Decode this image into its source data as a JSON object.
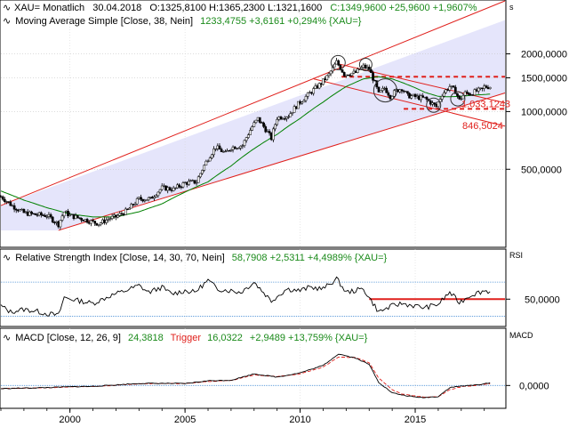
{
  "panel_price": {
    "header_symbol": "XAU= Monatlich",
    "header_date": "30.04.2018",
    "header_ohlc": "O:1325,8100 H:1365,2300 L:1321,1600",
    "header_close": "C:1349,9600 +25,9600 +1,9607%",
    "ma_label": "Moving Average Simple [Close, 38, Nein]",
    "ma_values": "1233,4755 +3,6161 +0,294% {XAU=}",
    "scale_letter": "s",
    "annotations": [
      "1.033,1243",
      "846,5024"
    ],
    "colors": {
      "candles": "#000000",
      "ma": "#008000",
      "channel_line": "#e0201c",
      "channel_fill": "#dcdcfa",
      "annotation": "#e0201c",
      "circle": "#333333"
    }
  },
  "panel_rsi": {
    "label": "Relative Strength Index [Close, 14, 30, 70, Nein]",
    "values": "58,7908 +2,5311 +4,4989% {XAU=}",
    "axis_title": "RSI",
    "colors": {
      "line": "#000000",
      "level": "#e0201c",
      "bands": "#4a8fd6"
    }
  },
  "panel_macd": {
    "label": "MACD [Close, 12, 26, 9]",
    "value": "24,3818",
    "trigger_label": "Trigger",
    "trigger_value": "16,0322",
    "change": "+2,9489 +13,759% {XAU=}",
    "axis_title": "MACD",
    "colors": {
      "macd": "#000000",
      "trigger": "#e0201c",
      "zero": "#4a8fd6"
    }
  },
  "chart_data": [
    {
      "type": "candlestick",
      "title": "XAU= Monatlich",
      "y_scale": "log",
      "y_ticks": [
        {
          "value": 2000,
          "label": "2000,0000"
        },
        {
          "value": 1500,
          "label": "1500,0000"
        },
        {
          "value": 1000,
          "label": "1000,0000"
        },
        {
          "value": 500,
          "label": "500,0000"
        }
      ],
      "x_ticks": [
        "2000",
        "2005",
        "2010",
        "2015"
      ],
      "ylim": [
        200,
        2600
      ],
      "series": [
        {
          "name": "XAU=",
          "points": [
            [
              "1997-01",
              360
            ],
            [
              "1997-07",
              322
            ],
            [
              "1998-01",
              296
            ],
            [
              "1998-07",
              290
            ],
            [
              "1999-01",
              287
            ],
            [
              "1999-07",
              258
            ],
            [
              "1999-10",
              300
            ],
            [
              "2000-01",
              287
            ],
            [
              "2000-07",
              276
            ],
            [
              "2001-01",
              265
            ],
            [
              "2001-04",
              260
            ],
            [
              "2001-10",
              278
            ],
            [
              "2002-01",
              282
            ],
            [
              "2002-07",
              305
            ],
            [
              "2003-01",
              350
            ],
            [
              "2003-07",
              350
            ],
            [
              "2004-01",
              400
            ],
            [
              "2004-07",
              393
            ],
            [
              "2005-01",
              424
            ],
            [
              "2005-07",
              430
            ],
            [
              "2006-01",
              569
            ],
            [
              "2006-05",
              653
            ],
            [
              "2006-10",
              604
            ],
            [
              "2007-01",
              650
            ],
            [
              "2007-07",
              666
            ],
            [
              "2007-12",
              834
            ],
            [
              "2008-03",
              917
            ],
            [
              "2008-10",
              725
            ],
            [
              "2009-01",
              928
            ],
            [
              "2009-07",
              955
            ],
            [
              "2009-12",
              1096
            ],
            [
              "2010-06",
              1245
            ],
            [
              "2010-12",
              1405
            ],
            [
              "2011-04",
              1556
            ],
            [
              "2011-08",
              1813
            ],
            [
              "2011-12",
              1565
            ],
            [
              "2012-06",
              1597
            ],
            [
              "2012-10",
              1719
            ],
            [
              "2013-01",
              1663
            ],
            [
              "2013-06",
              1234
            ],
            [
              "2013-09",
              1327
            ],
            [
              "2013-12",
              1201
            ],
            [
              "2014-03",
              1284
            ],
            [
              "2014-06",
              1322
            ],
            [
              "2014-09",
              1210
            ],
            [
              "2014-12",
              1199
            ],
            [
              "2015-03",
              1183
            ],
            [
              "2015-06",
              1172
            ],
            [
              "2015-09",
              1115
            ],
            [
              "2015-12",
              1061
            ],
            [
              "2016-03",
              1232
            ],
            [
              "2016-07",
              1351
            ],
            [
              "2016-10",
              1277
            ],
            [
              "2016-12",
              1146
            ],
            [
              "2017-03",
              1249
            ],
            [
              "2017-06",
              1242
            ],
            [
              "2017-09",
              1280
            ],
            [
              "2017-12",
              1303
            ],
            [
              "2018-01",
              1345
            ],
            [
              "2018-04",
              1350
            ]
          ]
        },
        {
          "name": "Moving Average Simple 38",
          "points": [
            [
              "1997-01",
              385
            ],
            [
              "1998-01",
              345
            ],
            [
              "1999-01",
              315
            ],
            [
              "2000-01",
              292
            ],
            [
              "2001-01",
              282
            ],
            [
              "2002-01",
              282
            ],
            [
              "2003-01",
              300
            ],
            [
              "2004-01",
              330
            ],
            [
              "2005-01",
              380
            ],
            [
              "2006-01",
              430
            ],
            [
              "2007-01",
              520
            ],
            [
              "2008-01",
              640
            ],
            [
              "2009-01",
              760
            ],
            [
              "2010-01",
              920
            ],
            [
              "2011-01",
              1120
            ],
            [
              "2012-01",
              1350
            ],
            [
              "2012-10",
              1480
            ],
            [
              "2013-06",
              1520
            ],
            [
              "2014-01",
              1480
            ],
            [
              "2014-06",
              1420
            ],
            [
              "2015-01",
              1330
            ],
            [
              "2015-06",
              1260
            ],
            [
              "2016-01",
              1200
            ],
            [
              "2016-06",
              1195
            ],
            [
              "2017-01",
              1200
            ],
            [
              "2017-06",
              1215
            ],
            [
              "2018-04",
              1233
            ]
          ]
        }
      ],
      "annotations": [
        {
          "text": "1.033,1243",
          "value": 1033
        },
        {
          "text": "846,5024",
          "value": 846.5
        },
        {
          "text": "resistance",
          "value": 1520
        }
      ]
    },
    {
      "type": "line",
      "title": "Relative Strength Index [Close, 14, 30, 70, Nein]",
      "ylim": [
        20,
        90
      ],
      "y_ticks": [
        {
          "value": 50,
          "label": "50,0000"
        }
      ],
      "levels": [
        30,
        50,
        70
      ],
      "series": [
        {
          "name": "RSI",
          "points": [
            [
              "1997-01",
              42
            ],
            [
              "1997-06",
              35
            ],
            [
              "1998-01",
              38
            ],
            [
              "1998-07",
              36
            ],
            [
              "1999-01",
              33
            ],
            [
              "1999-07",
              31
            ],
            [
              "1999-10",
              52
            ],
            [
              "2000-06",
              48
            ],
            [
              "2001-01",
              45
            ],
            [
              "2001-10",
              54
            ],
            [
              "2002-06",
              60
            ],
            [
              "2003-01",
              66
            ],
            [
              "2003-06",
              58
            ],
            [
              "2004-01",
              64
            ],
            [
              "2004-06",
              56
            ],
            [
              "2005-01",
              60
            ],
            [
              "2005-06",
              58
            ],
            [
              "2006-01",
              72
            ],
            [
              "2006-06",
              62
            ],
            [
              "2007-01",
              60
            ],
            [
              "2007-06",
              58
            ],
            [
              "2008-01",
              70
            ],
            [
              "2008-10",
              48
            ],
            [
              "2009-06",
              62
            ],
            [
              "2010-01",
              60
            ],
            [
              "2010-06",
              64
            ],
            [
              "2011-01",
              62
            ],
            [
              "2011-08",
              74
            ],
            [
              "2012-01",
              58
            ],
            [
              "2012-10",
              62
            ],
            [
              "2013-06",
              35
            ],
            [
              "2014-01",
              42
            ],
            [
              "2014-06",
              45
            ],
            [
              "2015-01",
              42
            ],
            [
              "2015-06",
              40
            ],
            [
              "2016-01",
              44
            ],
            [
              "2016-07",
              58
            ],
            [
              "2016-12",
              46
            ],
            [
              "2017-06",
              55
            ],
            [
              "2018-01",
              60
            ],
            [
              "2018-04",
              58.8
            ]
          ]
        }
      ]
    },
    {
      "type": "line",
      "title": "MACD [Close, 12, 26, 9]",
      "ylim": [
        -200,
        400
      ],
      "y_ticks": [
        {
          "value": 0,
          "label": "0,0000"
        }
      ],
      "series": [
        {
          "name": "MACD",
          "points": [
            [
              "1997-01",
              -30
            ],
            [
              "1998-01",
              -25
            ],
            [
              "1999-01",
              -20
            ],
            [
              "2000-01",
              -12
            ],
            [
              "2001-01",
              -8
            ],
            [
              "2002-01",
              5
            ],
            [
              "2003-01",
              20
            ],
            [
              "2004-01",
              20
            ],
            [
              "2005-01",
              18
            ],
            [
              "2006-01",
              45
            ],
            [
              "2007-01",
              50
            ],
            [
              "2008-01",
              110
            ],
            [
              "2009-01",
              80
            ],
            [
              "2010-01",
              120
            ],
            [
              "2011-01",
              190
            ],
            [
              "2011-09",
              300
            ],
            [
              "2012-06",
              260
            ],
            [
              "2013-01",
              200
            ],
            [
              "2013-06",
              30
            ],
            [
              "2014-01",
              -70
            ],
            [
              "2014-06",
              -90
            ],
            [
              "2015-01",
              -110
            ],
            [
              "2015-06",
              -115
            ],
            [
              "2016-01",
              -105
            ],
            [
              "2016-07",
              -20
            ],
            [
              "2017-01",
              -5
            ],
            [
              "2017-06",
              0
            ],
            [
              "2018-01",
              15
            ],
            [
              "2018-04",
              24.4
            ]
          ]
        },
        {
          "name": "Trigger",
          "points": [
            [
              "1997-01",
              -28
            ],
            [
              "1998-01",
              -26
            ],
            [
              "1999-01",
              -22
            ],
            [
              "2000-01",
              -14
            ],
            [
              "2001-01",
              -10
            ],
            [
              "2002-01",
              2
            ],
            [
              "2003-01",
              16
            ],
            [
              "2004-01",
              20
            ],
            [
              "2005-01",
              18
            ],
            [
              "2006-01",
              38
            ],
            [
              "2007-01",
              48
            ],
            [
              "2008-01",
              100
            ],
            [
              "2009-01",
              85
            ],
            [
              "2010-01",
              110
            ],
            [
              "2011-01",
              175
            ],
            [
              "2011-09",
              270
            ],
            [
              "2012-06",
              265
            ],
            [
              "2013-01",
              215
            ],
            [
              "2013-06",
              70
            ],
            [
              "2014-01",
              -40
            ],
            [
              "2014-06",
              -80
            ],
            [
              "2015-01",
              -100
            ],
            [
              "2015-06",
              -110
            ],
            [
              "2016-01",
              -108
            ],
            [
              "2016-07",
              -40
            ],
            [
              "2017-01",
              -12
            ],
            [
              "2017-06",
              -4
            ],
            [
              "2018-01",
              10
            ],
            [
              "2018-04",
              16
            ]
          ]
        }
      ]
    }
  ]
}
